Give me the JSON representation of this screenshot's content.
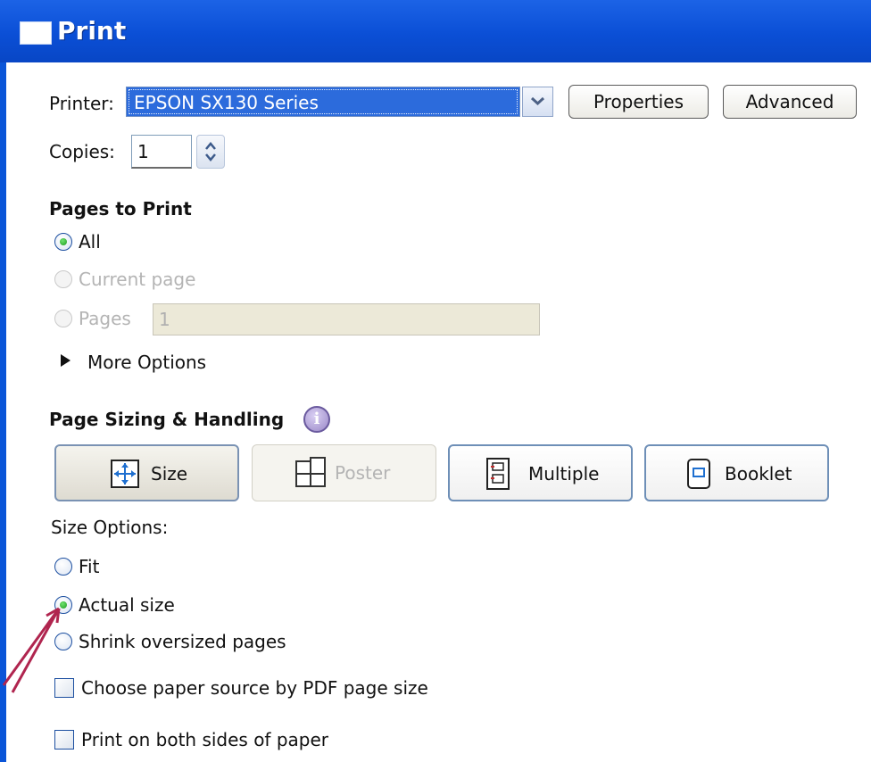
{
  "window": {
    "title": "Print"
  },
  "printer": {
    "label": "Printer:",
    "selected": "EPSON SX130 Series",
    "properties_label": "Properties",
    "advanced_label": "Advanced"
  },
  "copies": {
    "label": "Copies:",
    "value": "1"
  },
  "pages_to_print": {
    "heading": "Pages to Print",
    "all_label": "All",
    "current_page_label": "Current page",
    "pages_label": "Pages",
    "pages_value": "1",
    "selected": "All",
    "more_options_label": "More Options"
  },
  "sizing": {
    "heading": "Page Sizing & Handling",
    "info_glyph": "i",
    "modes": [
      {
        "label": "Size",
        "icon": "size-icon",
        "selected": true,
        "enabled": true
      },
      {
        "label": "Poster",
        "icon": "poster-icon",
        "selected": false,
        "enabled": false
      },
      {
        "label": "Multiple",
        "icon": "multiple-icon",
        "selected": false,
        "enabled": true
      },
      {
        "label": "Booklet",
        "icon": "booklet-icon",
        "selected": false,
        "enabled": true
      }
    ],
    "size_options_label": "Size Options:",
    "fit_label": "Fit",
    "actual_size_label": "Actual size",
    "shrink_label": "Shrink oversized pages",
    "selected": "Actual size",
    "paper_source_label": "Choose paper source by PDF page size",
    "paper_source_checked": false,
    "both_sides_label": "Print on both sides of paper",
    "both_sides_checked": false
  },
  "colors": {
    "titlebar": "#0b4fd6",
    "selection": "#2c6bdc",
    "annotation_arrow": "#b0254f"
  }
}
